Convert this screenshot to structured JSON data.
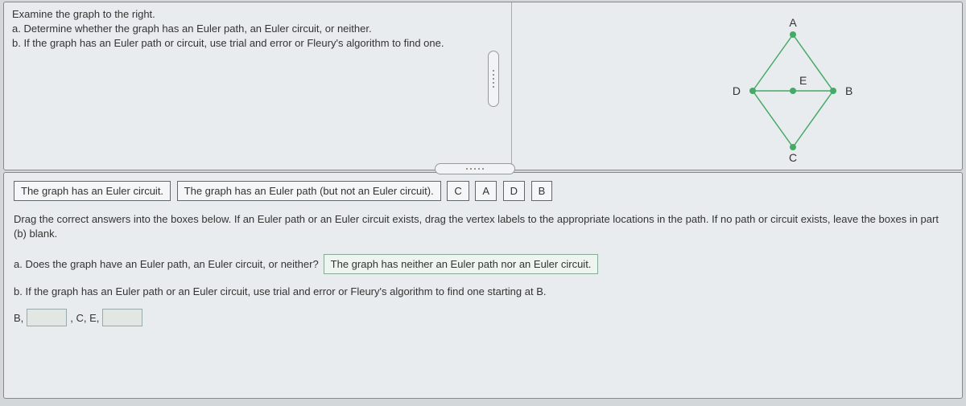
{
  "prompt": {
    "line1": "Examine the graph to the right.",
    "line2": "a. Determine whether the graph has an Euler path, an Euler circuit, or neither.",
    "line3": "b. If the graph has an Euler path or circuit, use trial and error or Fleury's algorithm to find one."
  },
  "graph": {
    "vertices": [
      "A",
      "B",
      "C",
      "D",
      "E"
    ]
  },
  "drag_source": {
    "opt_circuit": "The graph has an Euler circuit.",
    "opt_path": "The graph has an Euler path (but not an Euler circuit).",
    "v1": "C",
    "v2": "A",
    "v3": "D",
    "v4": "B"
  },
  "instruction": "Drag the correct answers into the boxes below. If an Euler path or an Euler circuit exists, drag the vertex labels to the appropriate locations in the path. If no path or circuit exists, leave the boxes in part (b) blank.",
  "qa": {
    "a_label": "a. Does the graph have an Euler path, an Euler circuit, or neither?",
    "a_answer": "The graph has neither an Euler path nor an Euler circuit.",
    "b_label": "b. If the graph has an Euler path or an Euler circuit, use trial and error or Fleury's algorithm to find one starting at B.",
    "seq_start": "B,",
    "seq_mid": ", C, E,"
  }
}
